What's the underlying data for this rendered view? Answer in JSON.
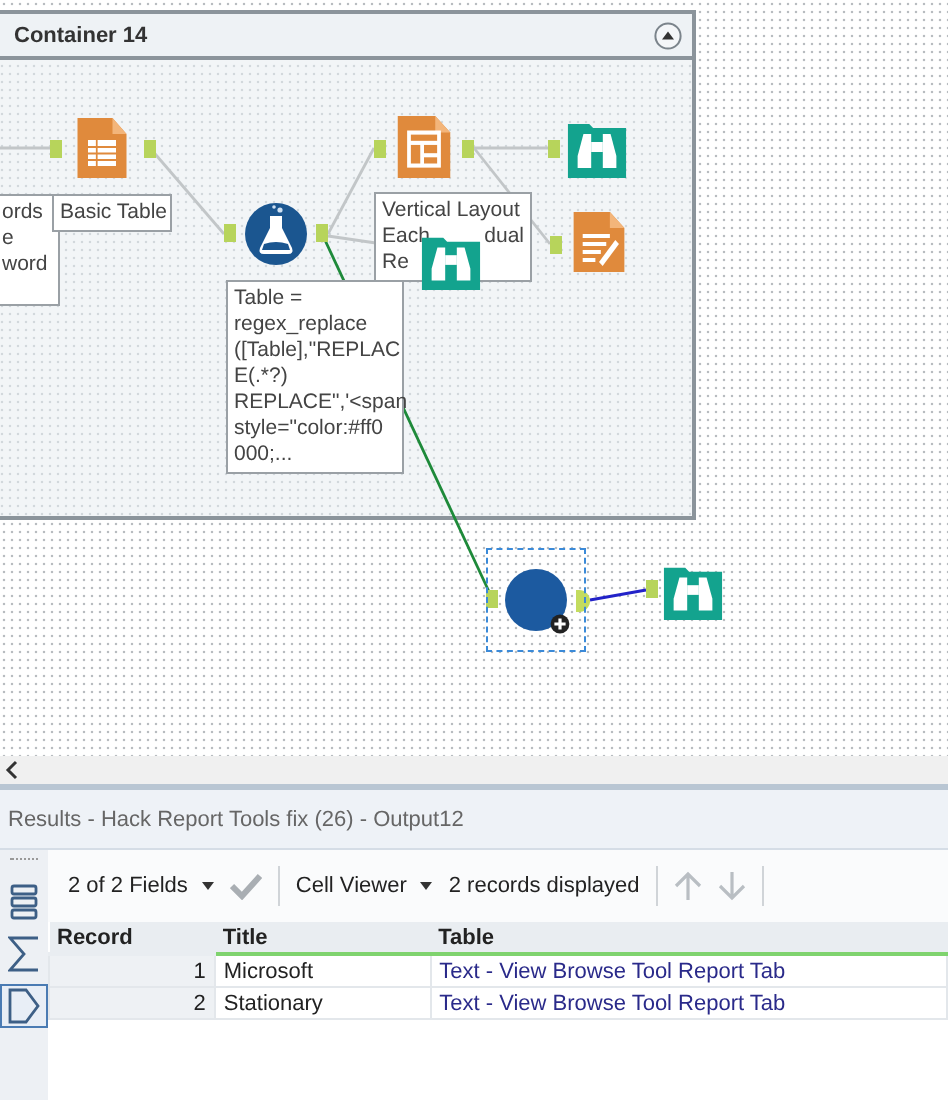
{
  "canvas": {
    "container": {
      "title": "Container 14",
      "expanded": true
    },
    "nodes": [
      {
        "kind": "table",
        "selected": false
      },
      {
        "kind": "formula",
        "selected": false
      },
      {
        "kind": "layout",
        "selected": false
      },
      {
        "kind": "browse",
        "selected": false
      },
      {
        "kind": "render",
        "selected": false
      },
      {
        "kind": "browse",
        "selected": false
      },
      {
        "kind": "tool",
        "selected": true
      },
      {
        "kind": "browse",
        "selected": false
      }
    ],
    "annotations": [
      {
        "lines": [
          [
            "ords"
          ],
          [
            "e"
          ],
          [
            "word"
          ]
        ]
      },
      {
        "lines": [
          [
            "Basic Table"
          ]
        ]
      },
      {
        "lines": [
          [
            "Table ="
          ],
          [
            "regex_replace"
          ],
          [
            "([Table],\"REPLAC"
          ],
          [
            "E(.*?)"
          ],
          [
            "REPLACE\",'<span"
          ],
          [
            "style=\"color:#ff0"
          ],
          [
            "000;..."
          ]
        ]
      },
      {
        "lines": [
          [
            "Vertical Layout"
          ],
          [
            "Each",
            "dual"
          ],
          [
            "Re"
          ]
        ]
      }
    ]
  },
  "results": {
    "title": "Results - Hack Report Tools fix (26) - Output12",
    "side_tabs": [
      {
        "kind": "list",
        "selected": false
      },
      {
        "kind": "sum",
        "selected": false
      },
      {
        "kind": "tag",
        "selected": true
      }
    ],
    "toolbar": {
      "fields": "2 of 2 Fields",
      "viewer": "Cell Viewer",
      "records": "2 records displayed",
      "nav_disabled": true
    },
    "table": {
      "columns": [
        "Record",
        "Title",
        "Table"
      ],
      "rows": [
        [
          "1",
          "Microsoft",
          "Text - View Browse Tool Report Tab"
        ],
        [
          "2",
          "Stationary",
          "Text - View Browse Tool Report Tab"
        ]
      ]
    }
  }
}
